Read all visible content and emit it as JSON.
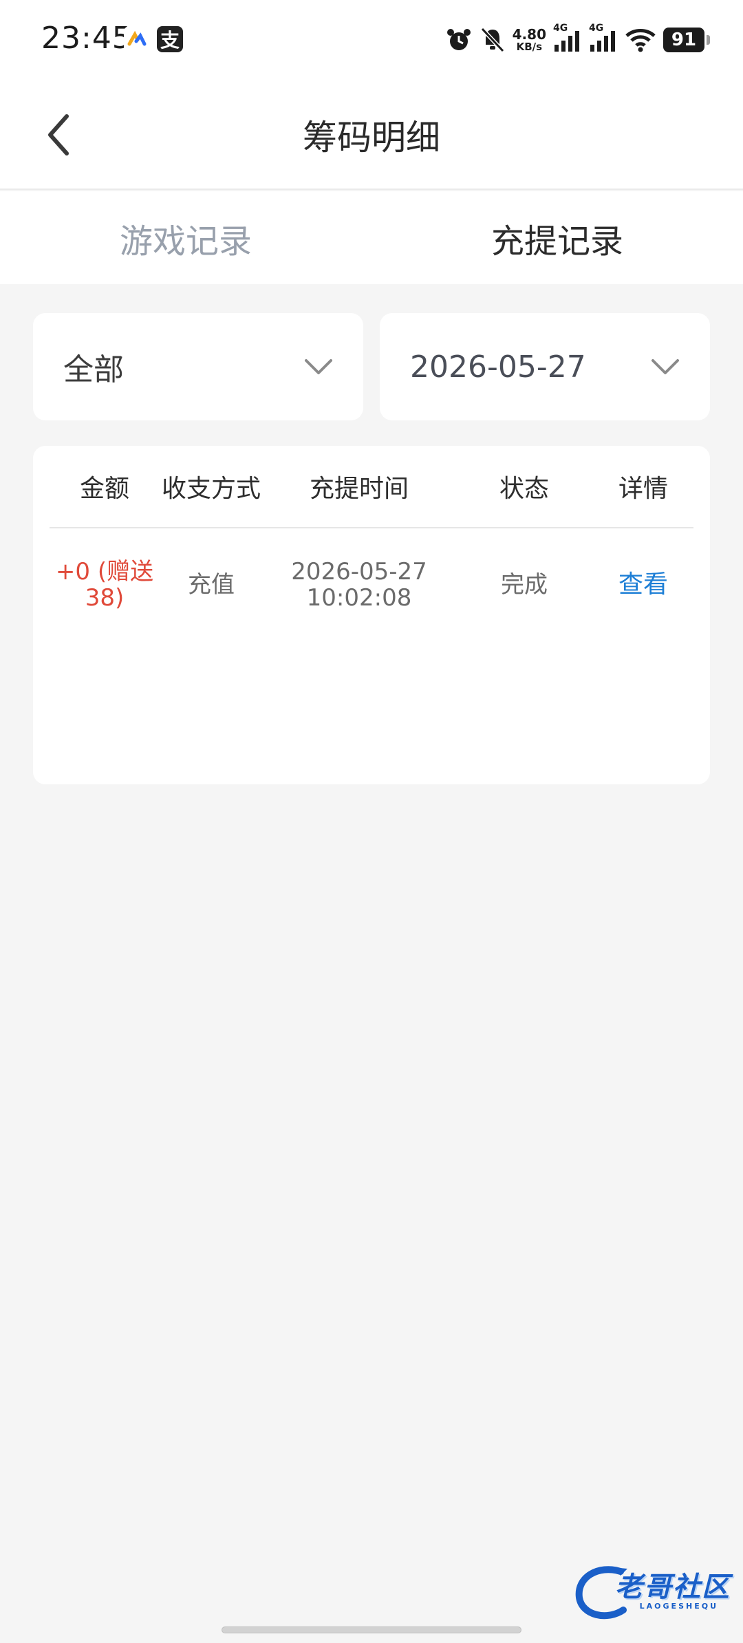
{
  "status": {
    "time": "23:45",
    "notif_b_label": "支",
    "speed_value": "4.80",
    "speed_unit": "KB/s",
    "net1": "4G",
    "net2": "4G",
    "battery": "91"
  },
  "header": {
    "title": "筹码明细"
  },
  "tabs": [
    {
      "label": "游戏记录"
    },
    {
      "label": "充提记录"
    }
  ],
  "filters": {
    "type_value": "全部",
    "date_value": "2026-05-27"
  },
  "table": {
    "headers": [
      "金额",
      "收支方式",
      "充提时间",
      "状态",
      "详情"
    ],
    "rows": [
      {
        "amount_line1": "+0 (赠送",
        "amount_line2": "38)",
        "method": "充值",
        "date": "2026-05-27",
        "time": "10:02:08",
        "status": "完成",
        "detail": "查看"
      }
    ]
  },
  "watermark": {
    "text": "老哥社区",
    "sub": "LAOGESHEQU"
  },
  "colors": {
    "accent_link": "#1e7fd6",
    "amount_red": "#e04a3a",
    "tab_inactive": "#98a0ac"
  }
}
